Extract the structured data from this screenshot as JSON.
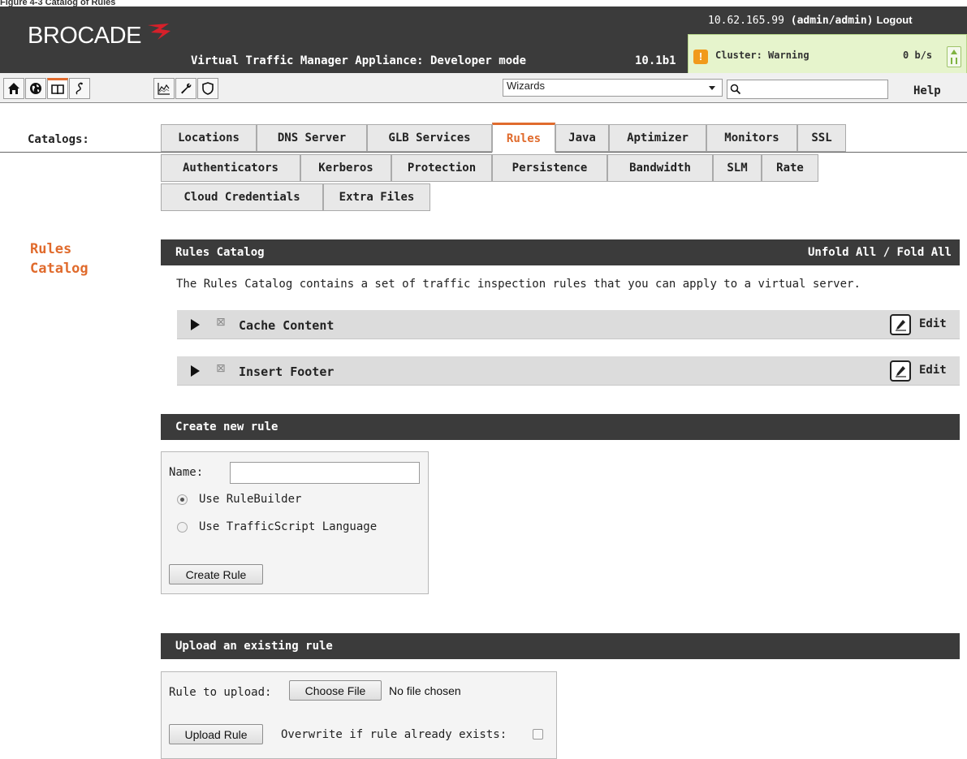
{
  "caption": "Figure 4-3 Catalog of Rules",
  "header": {
    "logo_text": "BROCADE",
    "app_title": "Virtual Traffic Manager Appliance: Developer mode",
    "version": "10.1b1",
    "ip": "10.62.165.99",
    "user": "(admin/admin)",
    "logout_label": "Logout",
    "cluster_status": "Cluster: Warning",
    "traffic_rate": "0 b/s",
    "accent_color": "#e06b2d",
    "warning_color": "#f19a1b"
  },
  "toolbar": {
    "icons": [
      "home-icon",
      "globe-icon",
      "book-icon",
      "sdk-icon",
      "chart-icon",
      "wrench-icon",
      "shield-icon"
    ],
    "wizards_value": "Wizards",
    "search_placeholder": "",
    "help_label": "Help"
  },
  "catalogs": {
    "label": "Catalogs:",
    "tabs_row1": [
      "Locations",
      "DNS Server",
      "GLB Services",
      "Rules",
      "Java",
      "Aptimizer",
      "Monitors",
      "SSL"
    ],
    "tabs_row2": [
      "Authenticators",
      "Kerberos",
      "Protection",
      "Persistence",
      "Bandwidth",
      "SLM",
      "Rate"
    ],
    "tabs_row3": [
      "Cloud Credentials",
      "Extra Files"
    ],
    "active_tab": "Rules"
  },
  "page": {
    "side_title_line1": "Rules",
    "side_title_line2": "Catalog"
  },
  "rules_catalog": {
    "title": "Rules Catalog",
    "fold_controls": "Unfold All / Fold All",
    "description": "The Rules Catalog contains a set of traffic inspection rules that you can apply to a virtual server.",
    "rules": [
      {
        "name": "Cache Content",
        "edit_label": "Edit"
      },
      {
        "name": "Insert Footer",
        "edit_label": "Edit"
      }
    ]
  },
  "create_rule": {
    "title": "Create new rule",
    "name_label": "Name:",
    "name_value": "",
    "option_rulebuilder": "Use RuleBuilder",
    "option_trafficscript": "Use TrafficScript Language",
    "selected_option": "Use RuleBuilder",
    "submit_label": "Create Rule"
  },
  "upload_rule": {
    "title": "Upload an existing rule",
    "file_label": "Rule to upload:",
    "choose_file_label": "Choose File",
    "file_status": "No file chosen",
    "submit_label": "Upload Rule",
    "overwrite_label": "Overwrite if rule already exists:",
    "overwrite_checked": false
  }
}
